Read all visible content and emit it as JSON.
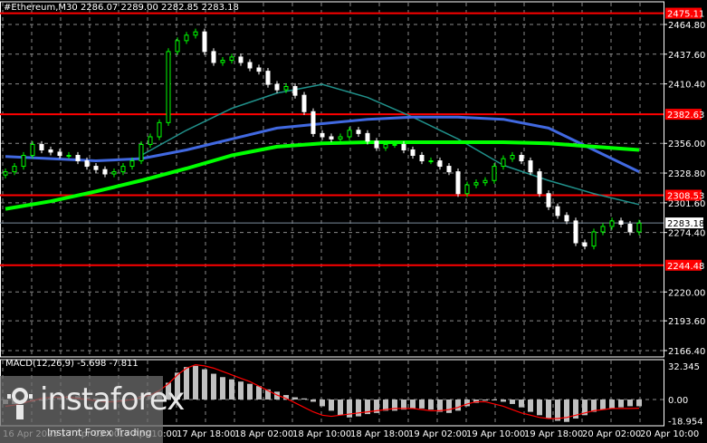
{
  "header": {
    "title": "#Ethereum,M30  2286.07 2289.00 2282.85 2283.18"
  },
  "logo": {
    "brand": "instaforex",
    "tagline": "Instant Forex Trading"
  },
  "colors": {
    "up": "#00ff00",
    "down": "#ffffff",
    "level": "#ff0000",
    "ma_slow": "#00ff00",
    "ma_mid": "#4169e1",
    "ma_fast": "#20908a",
    "macd_hist": "#c0c0c0",
    "macd_signal": "#ff0000",
    "grid": "#8a8a8a"
  },
  "chart_data": {
    "type": "candlestick",
    "symbol": "#Ethereum",
    "timeframe": "M30",
    "ylim": [
      2166.4,
      2475.11
    ],
    "y_ticks": [
      "2464.80",
      "2437.60",
      "2410.40",
      "2356.00",
      "2328.80",
      "2301.60",
      "2274.40",
      "2220.00",
      "2193.60",
      "2166.40"
    ],
    "levels": [
      {
        "label": "2475.11",
        "value": 2475.11
      },
      {
        "label": "2382.63",
        "value": 2382.63
      },
      {
        "label": "2308.53",
        "value": 2308.53
      },
      {
        "label": "2244.48",
        "value": 2244.48
      }
    ],
    "current_price": {
      "label": "2283.18",
      "value": 2283.18
    },
    "x_labels": [
      "16 Apr 2025",
      "17 Apr 02:00",
      "17 Apr 10:00",
      "17 Apr 18:00",
      "18 Apr 02:00",
      "18 Apr 10:00",
      "18 Apr 18:00",
      "19 Apr 02:00",
      "19 Apr 10:00",
      "19 Apr 18:00",
      "20 Apr 02:00",
      "20 Apr 10:00"
    ],
    "closes": [
      2330,
      2335,
      2345,
      2355,
      2350,
      2348,
      2345,
      2345,
      2340,
      2335,
      2332,
      2328,
      2330,
      2335,
      2340,
      2355,
      2362,
      2375,
      2440,
      2450,
      2455,
      2458,
      2440,
      2430,
      2432,
      2435,
      2430,
      2425,
      2422,
      2410,
      2405,
      2408,
      2400,
      2385,
      2365,
      2362,
      2360,
      2362,
      2368,
      2365,
      2358,
      2352,
      2355,
      2355,
      2350,
      2345,
      2340,
      2340,
      2335,
      2330,
      2310,
      2318,
      2320,
      2322,
      2335,
      2342,
      2345,
      2340,
      2330,
      2310,
      2298,
      2290,
      2285,
      2265,
      2262,
      2275,
      2280,
      2285,
      2282,
      2275,
      2283
    ],
    "ma_step": 5,
    "ma_slow": [
      2296,
      2303,
      2312,
      2322,
      2333,
      2345,
      2353,
      2356,
      2357,
      2357,
      2357,
      2357,
      2356,
      2353,
      2350
    ],
    "ma_mid": [
      2344,
      2342,
      2340,
      2342,
      2350,
      2360,
      2370,
      2374,
      2378,
      2380,
      2380,
      2378,
      2370,
      2350,
      2330
    ],
    "ma_fast": [
      null,
      null,
      null,
      2345,
      2368,
      2388,
      2402,
      2410,
      2398,
      2380,
      2360,
      2336,
      2322,
      2310,
      2300
    ],
    "macd": {
      "label": "MACD(12,26,9) -5.698 -7.811",
      "ylim": [
        -18.954,
        32.345
      ],
      "y_ticks": [
        "32.345",
        "0.00",
        "-18.954"
      ],
      "histogram": [
        -4,
        -4,
        -3,
        -2,
        -1,
        1,
        2,
        3,
        3,
        2,
        1,
        0,
        -1,
        -2,
        0,
        3,
        5,
        7,
        15,
        24,
        29,
        30,
        27,
        23,
        20,
        18,
        16,
        14,
        12,
        9,
        7,
        4,
        2,
        1,
        -2,
        -6,
        -10,
        -14,
        -16,
        -15,
        -13,
        -12,
        -10,
        -10,
        -9,
        -8,
        -8,
        -9,
        -11,
        -12,
        -10,
        -6,
        -3,
        -1,
        0,
        -2,
        -4,
        -7,
        -11,
        -14,
        -17,
        -19,
        -20,
        -17,
        -14,
        -11,
        -9,
        -8,
        -7,
        -6,
        -6
      ],
      "signal": [
        -6,
        -5,
        -3,
        -1,
        1,
        2,
        2,
        2,
        1,
        0,
        -1,
        -2,
        -2,
        -1,
        0,
        2,
        4,
        8,
        14,
        22,
        28,
        31,
        30,
        28,
        25,
        22,
        19,
        16,
        12,
        8,
        4,
        1,
        -3,
        -7,
        -11,
        -14,
        -15,
        -14,
        -13,
        -12,
        -11,
        -10,
        -9,
        -8,
        -8,
        -8,
        -9,
        -10,
        -10,
        -9,
        -7,
        -4,
        -2,
        -2,
        -4,
        -6,
        -9,
        -12,
        -14,
        -16,
        -17,
        -17,
        -16,
        -14,
        -12,
        -10,
        -9,
        -8,
        -8,
        -8,
        -7.8
      ]
    }
  }
}
